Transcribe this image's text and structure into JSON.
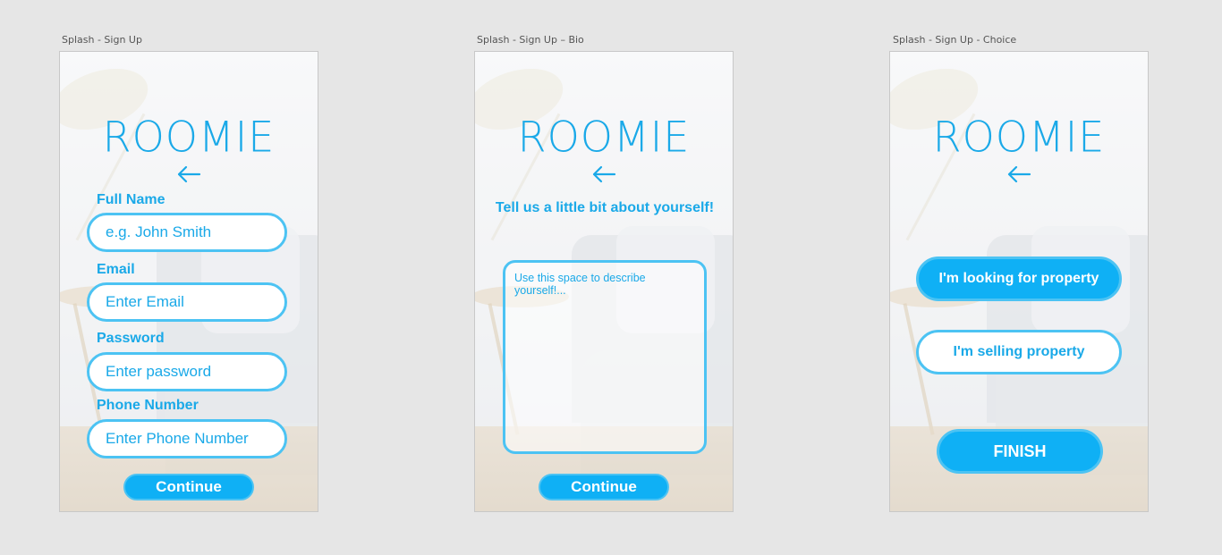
{
  "artboards": [
    {
      "label": "Splash - Sign Up"
    },
    {
      "label": "Splash - Sign Up – Bio"
    },
    {
      "label": "Splash - Sign Up - Choice"
    }
  ],
  "brand": {
    "logo_text": "ROOMIE",
    "accent": "#1aa9e8",
    "button_fill": "#0fb0f5",
    "border": "#4cc3f3"
  },
  "signup": {
    "fields": [
      {
        "label": "Full Name",
        "placeholder": "e.g. John Smith"
      },
      {
        "label": "Email",
        "placeholder": "Enter Email"
      },
      {
        "label": "Password",
        "placeholder": "Enter password"
      },
      {
        "label": "Phone Number",
        "placeholder": "Enter Phone Number"
      }
    ],
    "continue_label": "Continue"
  },
  "bio": {
    "prompt": "Tell us a little bit about yourself!",
    "placeholder": "Use this space to describe yourself!...",
    "continue_label": "Continue"
  },
  "choice": {
    "looking_label": "I'm looking for property",
    "selling_label": "I'm selling property",
    "finish_label": "FINISH"
  },
  "icons": {
    "back": "arrow-left-icon"
  }
}
